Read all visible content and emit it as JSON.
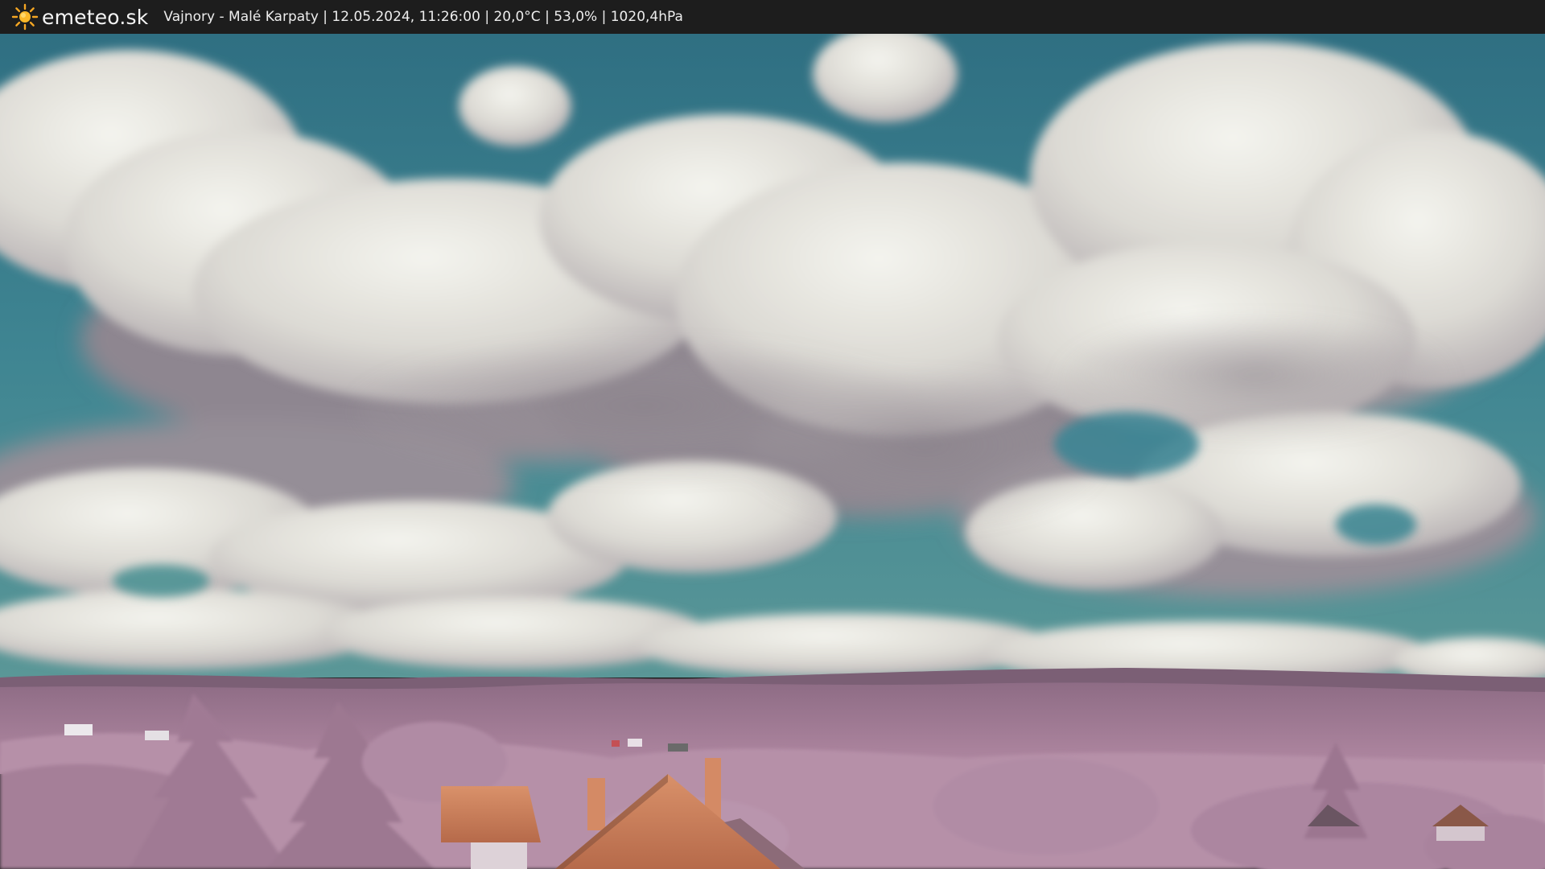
{
  "header": {
    "brand": "emeteo.sk",
    "caption": "Vajnory - Malé Karpaty | 12.05.2024, 11:26:00 | 20,0°C | 53,0% | 1020,4hPa",
    "logo_icon": "sun-icon"
  },
  "scene": {
    "description_icon": "webcam-image",
    "colors": {
      "sky": "#3f7d8c",
      "cloud": "#e9e9e2",
      "cloud_shadow": "#8f8790",
      "vegetation": "#b68aa6",
      "roof": "#c97550"
    }
  }
}
